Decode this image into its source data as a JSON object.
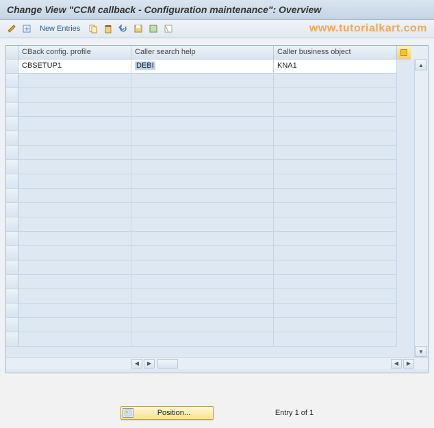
{
  "title": "Change View \"CCM callback - Configuration maintenance\": Overview",
  "toolbar": {
    "new_entries": "New Entries"
  },
  "watermark": "www.tutorialkart.com",
  "table": {
    "columns": {
      "c1": "CBack config. profile",
      "c2": "Caller search help",
      "c3": "Caller business object"
    },
    "rows": [
      {
        "c1": "CBSETUP1",
        "c2": "DEBI",
        "c3": "KNA1"
      }
    ]
  },
  "footer": {
    "position_label": "Position...",
    "entry_text": "Entry 1 of 1"
  }
}
